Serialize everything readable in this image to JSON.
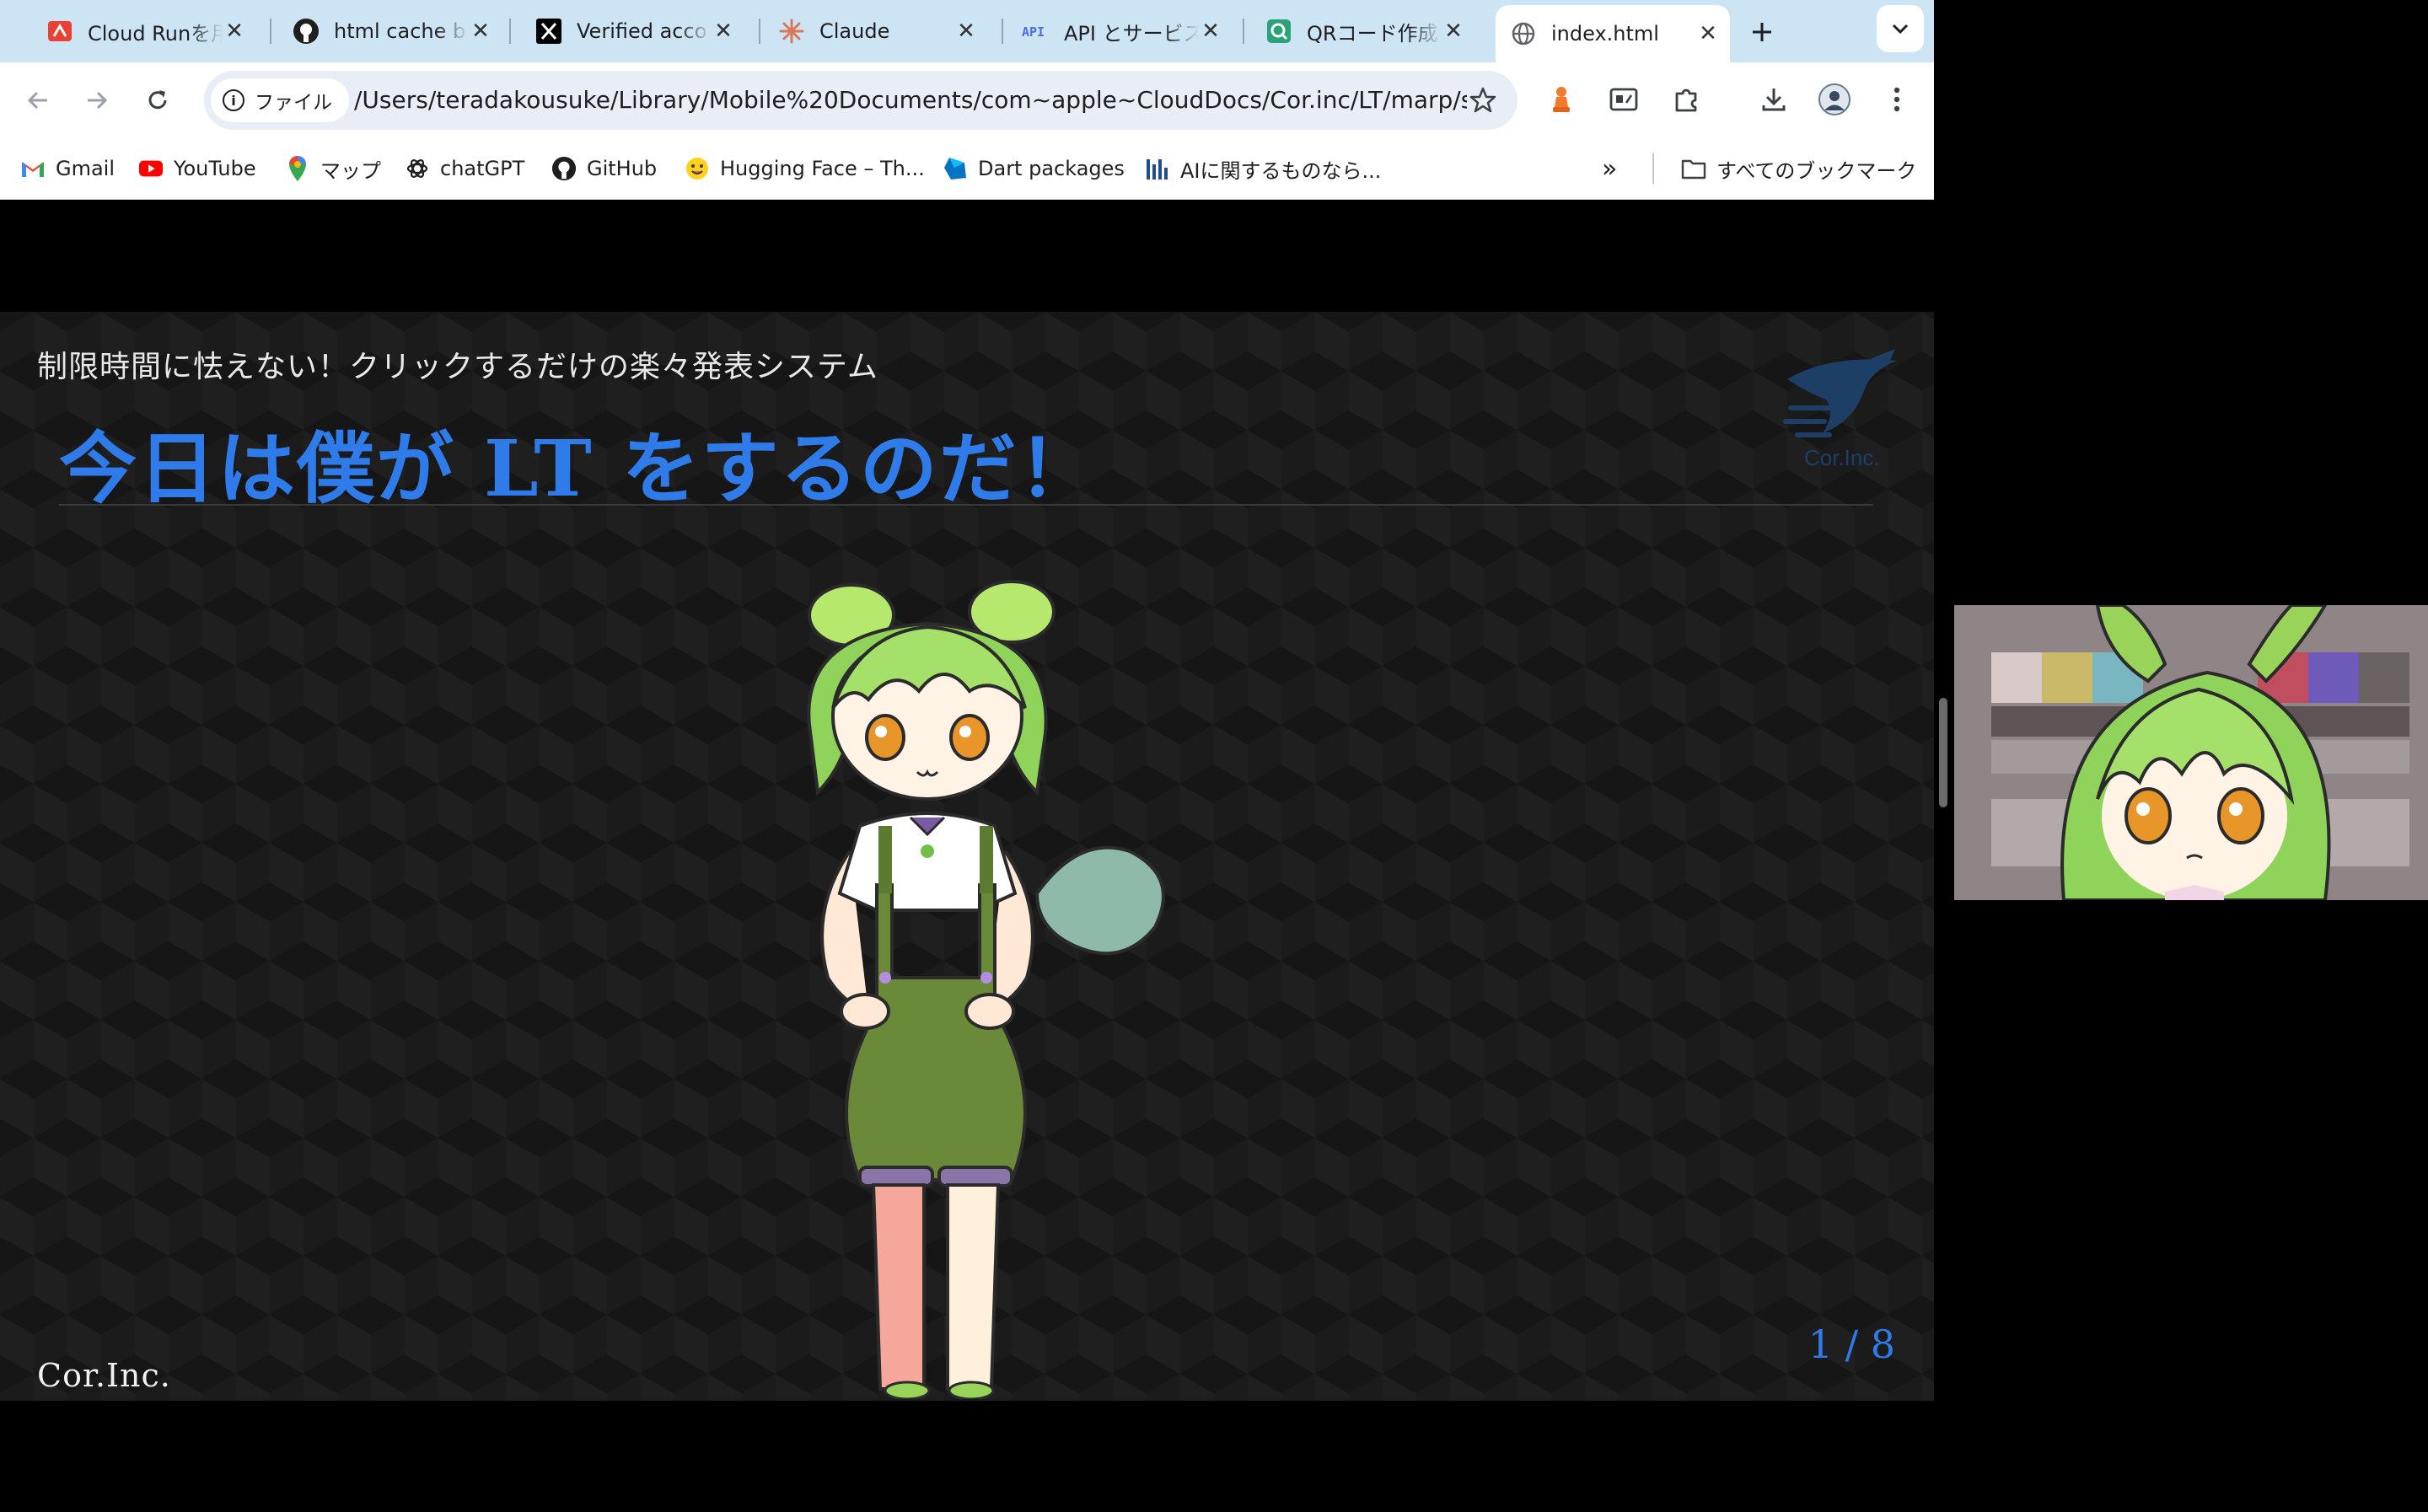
{
  "tabs": [
    {
      "title": "Cloud Runを用",
      "icon": "google-cloud-icon"
    },
    {
      "title": "html cache b",
      "icon": "github-icon"
    },
    {
      "title": "Verified acco",
      "icon": "x-icon"
    },
    {
      "title": "Claude",
      "icon": "claude-icon"
    },
    {
      "title": "API とサービス",
      "icon": "api-icon"
    },
    {
      "title": "QRコード作成",
      "icon": "qr-icon"
    },
    {
      "title": "index.html",
      "icon": "globe-icon",
      "active": true
    }
  ],
  "toolbar": {
    "chip_label": "ファイル",
    "url": "/Users/teradakousuke/Library/Mobile%20Documents/com~apple~CloudDocs/Cor.inc/LT/marp/sr..."
  },
  "bookmarks": {
    "items": [
      {
        "label": "Gmail",
        "icon": "gmail-icon"
      },
      {
        "label": "YouTube",
        "icon": "youtube-icon"
      },
      {
        "label": "マップ",
        "icon": "maps-icon"
      },
      {
        "label": "chatGPT",
        "icon": "chatgpt-icon"
      },
      {
        "label": "GitHub",
        "icon": "github-icon"
      },
      {
        "label": "Hugging Face – Th...",
        "icon": "huggingface-icon"
      },
      {
        "label": "Dart packages",
        "icon": "dart-icon"
      },
      {
        "label": "AIに関するものなら...",
        "icon": "ai-icon"
      }
    ],
    "more": "»",
    "all_bookmarks": "すべてのブックマーク"
  },
  "slide": {
    "subtitle": "制限時間に怯えない！クリックするだけの楽々発表システム",
    "title": "今日は僕が LT をするのだ！",
    "logo_text": "Cor.Inc.",
    "footer": "Cor.Inc.",
    "page": "1 / 8"
  },
  "colors": {
    "accent": "#2f7bea",
    "tabstrip": "#cde4f4",
    "slide_bg": "#1b1b1b"
  }
}
